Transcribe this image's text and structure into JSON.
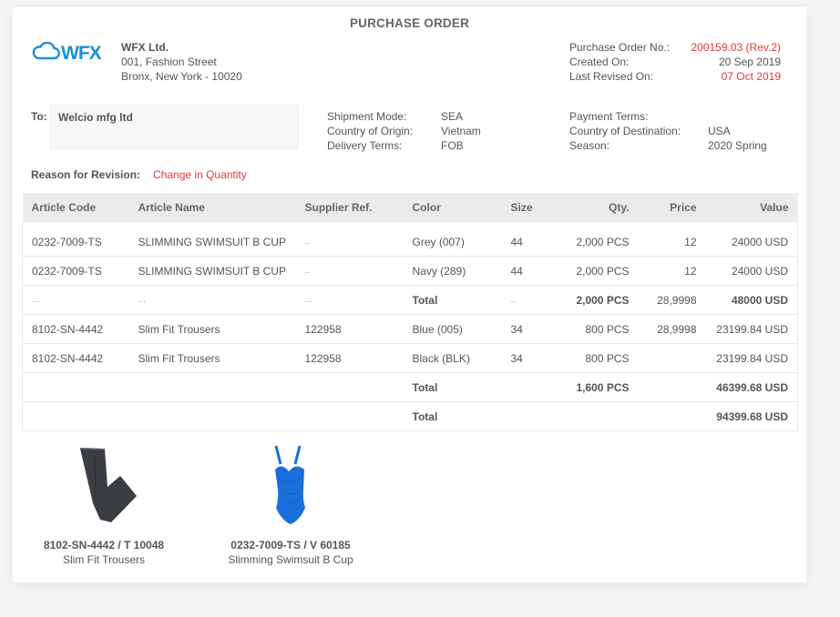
{
  "document": {
    "title": "PURCHASE ORDER",
    "logo_text": "WFX",
    "logo_color": "#1e8fd4",
    "accent_red": "#e53935"
  },
  "company": {
    "name": "WFX Ltd.",
    "address_line1": "001, Fashion Street",
    "address_line2": "Bronx, New York - 10020"
  },
  "po_info": {
    "po_no_label": "Purchase Order No.:",
    "po_no_value": "200159.03 (Rev.2)",
    "created_label": "Created On:",
    "created_value": "20 Sep 2019",
    "revised_label": "Last Revised On:",
    "revised_value": "07 Oct 2019"
  },
  "to": {
    "label": "To:",
    "value": "Welcio mfg ltd"
  },
  "shipment": {
    "mode_label": "Shipment Mode:",
    "mode_value": "SEA",
    "origin_label": "Country of Origin:",
    "origin_value": "Vietnam",
    "delivery_label": "Delivery Terms:",
    "delivery_value": "FOB"
  },
  "payment": {
    "terms_label": "Payment Terms:",
    "terms_value": "",
    "destination_label": "Country of Destination:",
    "destination_value": "USA",
    "season_label": "Season:",
    "season_value": "2020 Spring"
  },
  "reason": {
    "label": "Reason for Revision:",
    "value": "Change in Quantity"
  },
  "table": {
    "headers": [
      "Article Code",
      "Article Name",
      "Supplier Ref.",
      "Color",
      "Size",
      "Qty.",
      "Price",
      "Value"
    ],
    "rows": [
      [
        "0232-7009-TS",
        "SLIMMING SWIMSUIT B CUP",
        "..",
        "Grey (007)",
        "44",
        "2,000 PCS",
        "12",
        "24000 USD"
      ],
      [
        "0232-7009-TS",
        "SLIMMING SWIMSUIT B CUP",
        "..",
        "Navy (289)",
        "44",
        "2,000 PCS",
        "12",
        "24000 USD"
      ],
      [
        "...",
        "...",
        "...",
        "Total",
        "..",
        "2,000 PCS",
        "28,9998",
        "48000 USD"
      ],
      [
        "8102-SN-4442",
        "Slim Fit Trousers",
        "122958",
        "Blue (005)",
        "34",
        "800 PCS",
        "28,9998",
        "23199.84 USD"
      ],
      [
        "8102-SN-4442",
        "Slim Fit Trousers",
        "122958",
        "Black (BLK)",
        "34",
        "800 PCS",
        "",
        "23199.84 USD"
      ],
      [
        "",
        "",
        "",
        "Total",
        "",
        "1,600 PCS",
        "",
        "46399.68 USD"
      ],
      [
        "",
        "",
        "",
        "Total",
        "",
        "",
        "",
        "94399.68 USD"
      ]
    ]
  },
  "products": [
    {
      "code": "8102-SN-4442 / T 10048",
      "name": "Slim Fit Trousers",
      "icon": "trousers-image"
    },
    {
      "code": "0232-7009-TS / V 60185",
      "name": "Slimming Swimsuit B Cup",
      "icon": "swimsuit-image"
    }
  ]
}
